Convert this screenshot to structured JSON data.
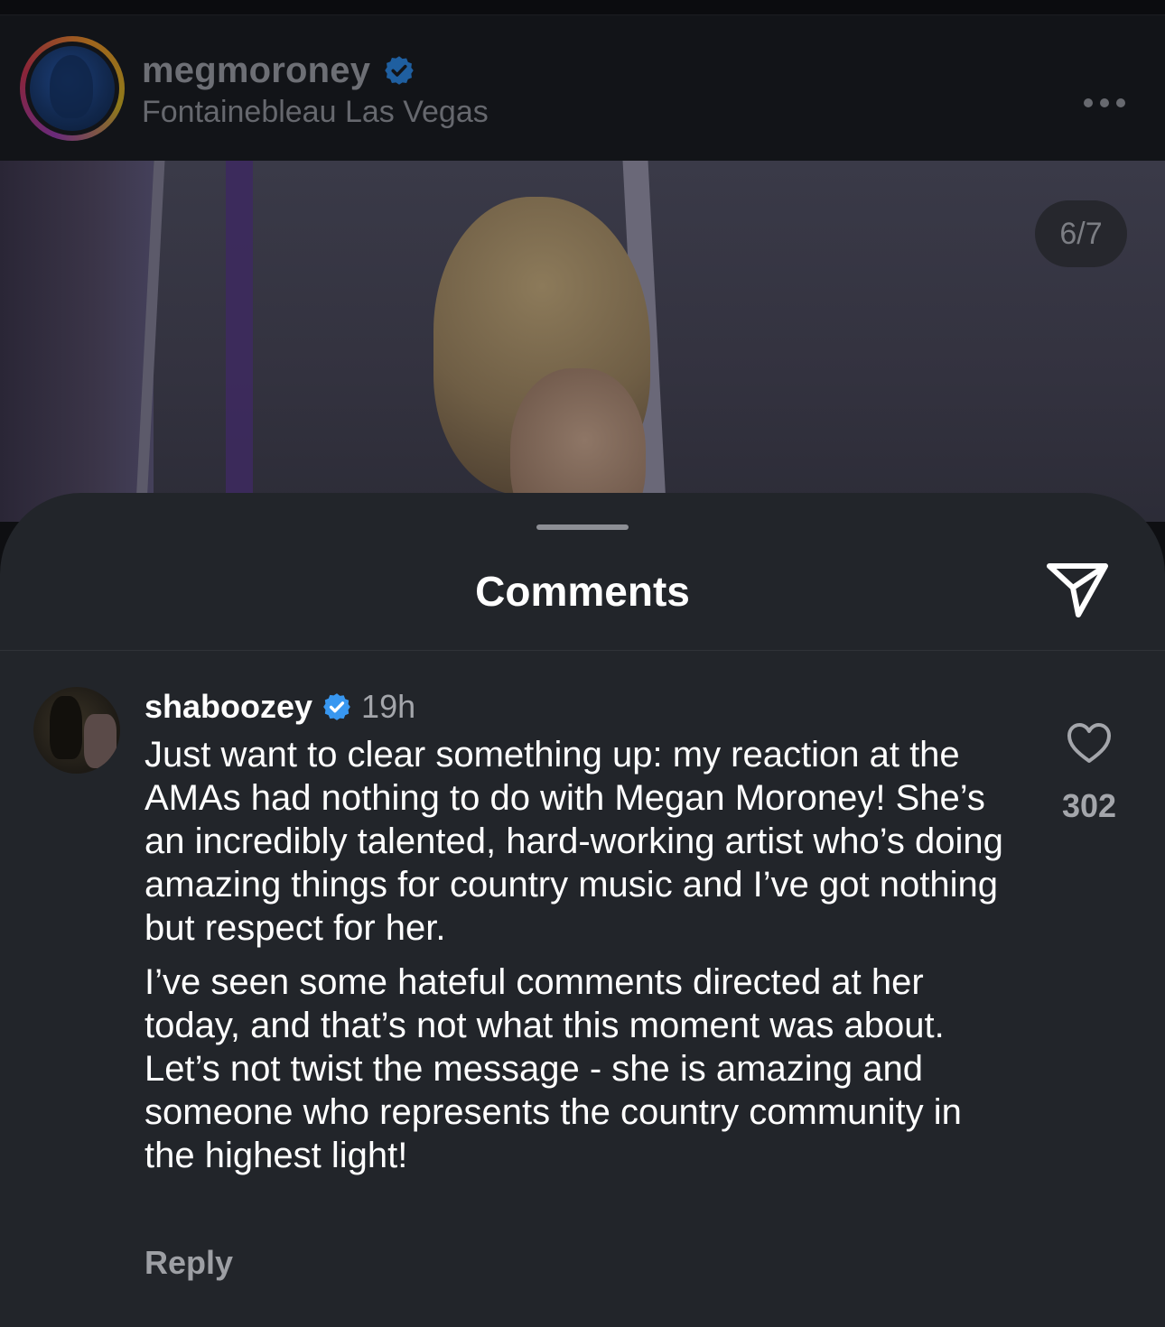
{
  "post": {
    "username": "megmoroney",
    "location": "Fontainebleau Las Vegas",
    "media_counter": "6/7"
  },
  "comments_sheet": {
    "title": "Comments",
    "comment": {
      "username": "shaboozey",
      "time": "19h",
      "paragraph_1": "Just want to clear something up: my reaction at the AMAs had nothing to do with Megan Moroney! She’s an incredibly talented, hard-working artist who’s doing amazing things for country music and I’ve got nothing but respect for her.",
      "paragraph_2": "I’ve seen some hateful comments directed at her today, and that’s not what this moment was about. Let’s not twist the message - she is amazing and someone who represents the country community in the highest light!",
      "reply_label": "Reply",
      "like_count": "302"
    }
  },
  "icons": {
    "verified": "verified-badge-icon",
    "more": "more-icon",
    "share": "share-icon",
    "like": "heart-icon"
  },
  "colors": {
    "verified_blue": "#3897f0",
    "sheet_bg": "#22252a",
    "header_bg": "#121418"
  }
}
